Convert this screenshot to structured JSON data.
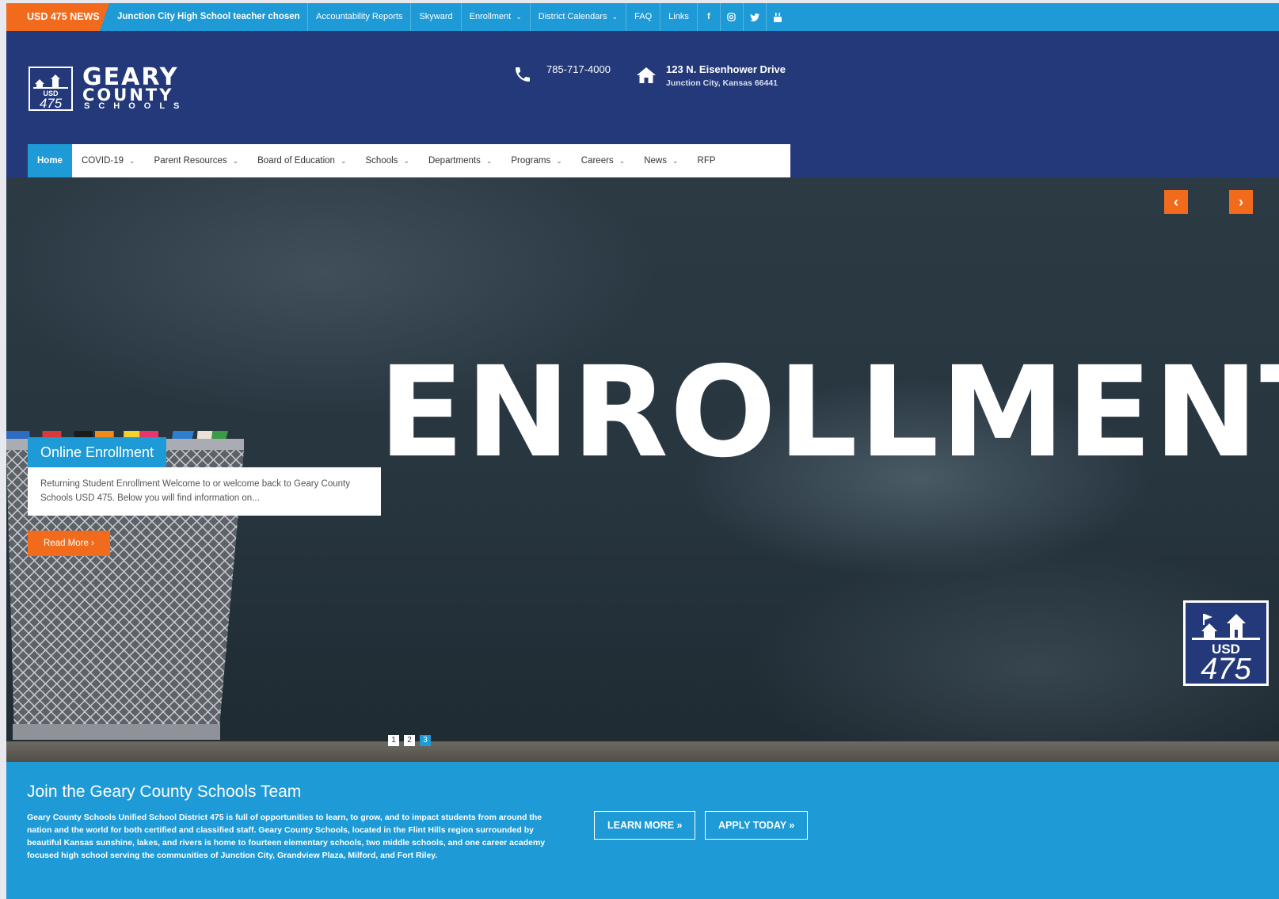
{
  "topbar": {
    "news_tag": "USD 475 NEWS",
    "headline": "Junction City High School teacher chosen",
    "links": [
      {
        "label": "Accountability Reports",
        "dropdown": false
      },
      {
        "label": "Skyward",
        "dropdown": false
      },
      {
        "label": "Enrollment",
        "dropdown": true
      },
      {
        "label": "District Calendars",
        "dropdown": true
      },
      {
        "label": "FAQ",
        "dropdown": false
      },
      {
        "label": "Links",
        "dropdown": false
      }
    ],
    "social": [
      "facebook-icon",
      "instagram-icon",
      "twitter-icon",
      "youtube-icon"
    ]
  },
  "header": {
    "logo_line1": "GEARY",
    "logo_line2": "COUNTY",
    "logo_line3": "SCHOOLS",
    "logo_badge_top": "USD",
    "logo_badge_num": "475",
    "phone": "785-717-4000",
    "address_line1": "123 N. Eisenhower Drive",
    "address_line2": "Junction City, Kansas 66441"
  },
  "nav": {
    "items": [
      {
        "label": "Home"
      },
      {
        "label": "COVID-19"
      },
      {
        "label": "Parent Resources"
      },
      {
        "label": "Board of Education"
      },
      {
        "label": "Schools"
      },
      {
        "label": "Departments"
      },
      {
        "label": "Programs"
      },
      {
        "label": "Careers"
      },
      {
        "label": "News"
      },
      {
        "label": "RFP"
      }
    ]
  },
  "hero": {
    "word": "ENROLLMENT",
    "caption_title": "Online Enrollment",
    "caption_text": "Returning Student Enrollment Welcome to or welcome back to Geary County Schools USD 475. Below you will find information on...",
    "read_more": "Read More ›",
    "prev": "‹",
    "next": "›",
    "dots": [
      "1",
      "2",
      "3"
    ],
    "active_dot": 3
  },
  "band": {
    "title": "Join the Geary County Schools Team",
    "text": "Geary County Schools Unified School District 475 is full of opportunities to learn, to grow, and to impact students from around the nation and the world for both certified and classified staff. Geary County Schools, located in the Flint Hills region surrounded by beautiful Kansas sunshine, lakes, and rivers is home to fourteen elementary schools, two middle schools, and one career academy focused high school serving the communities of Junction City, Grandview Plaza, Milford, and Fort Riley.",
    "learn_more": "LEARN MORE »",
    "apply_today": "APPLY TODAY »"
  },
  "colors": {
    "navy": "#24397a",
    "blue": "#1e9ad6",
    "orange": "#f26b1d"
  }
}
